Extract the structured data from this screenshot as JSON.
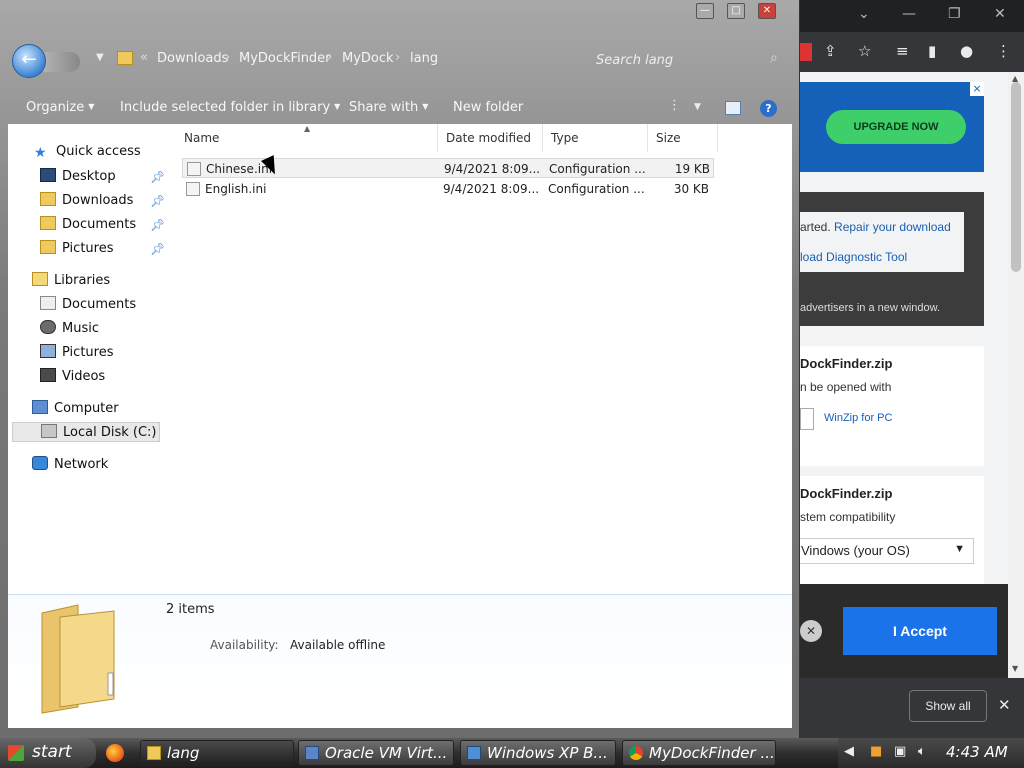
{
  "explorer": {
    "breadcrumb": [
      "Downloads",
      "MyDockFinder",
      "MyDock",
      "lang"
    ],
    "breadcrumb_overflow": "«",
    "search_placeholder": "Search lang",
    "toolbar": {
      "organize": "Organize",
      "include": "Include selected folder in library",
      "share": "Share with",
      "new_folder": "New folder",
      "help": "?"
    },
    "nav": {
      "quick_access": "Quick access",
      "desktop": "Desktop",
      "downloads": "Downloads",
      "documents": "Documents",
      "pictures": "Pictures",
      "libraries": "Libraries",
      "lib_documents": "Documents",
      "lib_music": "Music",
      "lib_pictures": "Pictures",
      "lib_videos": "Videos",
      "computer": "Computer",
      "local_disk": "Local Disk (C:)",
      "network": "Network"
    },
    "columns": {
      "name": "Name",
      "date": "Date modified",
      "type": "Type",
      "size": "Size"
    },
    "files": [
      {
        "name": "Chinese.ini",
        "date": "9/4/2021 8:09...",
        "type": "Configuration ...",
        "size": "19 KB"
      },
      {
        "name": "English.ini",
        "date": "9/4/2021 8:09...",
        "type": "Configuration ...",
        "size": "30 KB"
      }
    ],
    "details": {
      "count": "2 items",
      "availability_label": "Availability:",
      "availability_value": "Available offline"
    }
  },
  "browser": {
    "ad_button": "UPGRADE NOW",
    "ad_close": "×",
    "line1_prefix": "arted.",
    "line1_link": "Repair your download",
    "line2_link": "load Diagnostic Tool",
    "note": "advertisers in a new window.",
    "card1": {
      "title": "DockFinder.zip",
      "subtitle": "n be opened with",
      "app": "WinZip for PC"
    },
    "card2": {
      "title": "DockFinder.zip",
      "subtitle": "stem compatibility",
      "select": "Vindows (your OS)"
    },
    "accept": "I Accept",
    "show_all": "Show all"
  },
  "taskbar": {
    "start": "start",
    "buttons": [
      "lang",
      "Oracle VM Virt...",
      "Windows XP B...",
      "MyDockFinder ..."
    ],
    "clock": "4:43 AM"
  }
}
